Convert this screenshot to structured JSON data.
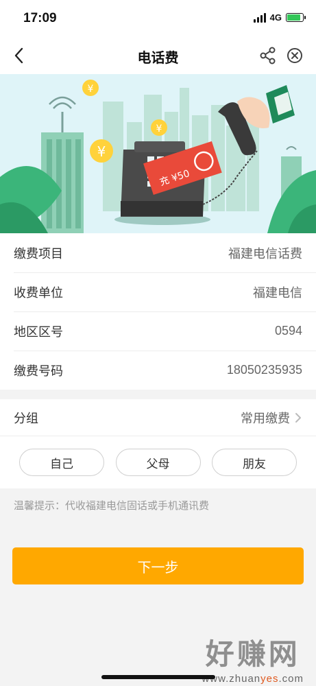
{
  "status_bar": {
    "time": "17:09",
    "network": "4G",
    "battery_level": 0.85,
    "battery_charging": true
  },
  "nav": {
    "title": "电话费",
    "back_icon": "chevron-left-icon",
    "share_icon": "share-icon",
    "close_icon": "close-circle-icon"
  },
  "banner": {
    "coupon_text": "充 ¥50"
  },
  "info": {
    "rows": [
      {
        "label": "缴费项目",
        "value": "福建电信话费"
      },
      {
        "label": "收费单位",
        "value": "福建电信"
      },
      {
        "label": "地区区号",
        "value": "0594"
      },
      {
        "label": "缴费号码",
        "value": "18050235935"
      }
    ]
  },
  "group": {
    "label": "分组",
    "value": "常用缴费",
    "chips": [
      "自己",
      "父母",
      "朋友"
    ]
  },
  "tip": "温馨提示：代收福建电信固话或手机通讯费",
  "next_button": "下一步",
  "watermark": {
    "main": "好赚网",
    "site_prefix": "www.zhuan",
    "site_accent": "yes",
    "site_suffix": ".com"
  },
  "colors": {
    "primary_button": "#ffa800",
    "banner_sky": "#d9f2f7",
    "banner_green": "#3bb57a",
    "coupon_red": "#e94a3a"
  }
}
